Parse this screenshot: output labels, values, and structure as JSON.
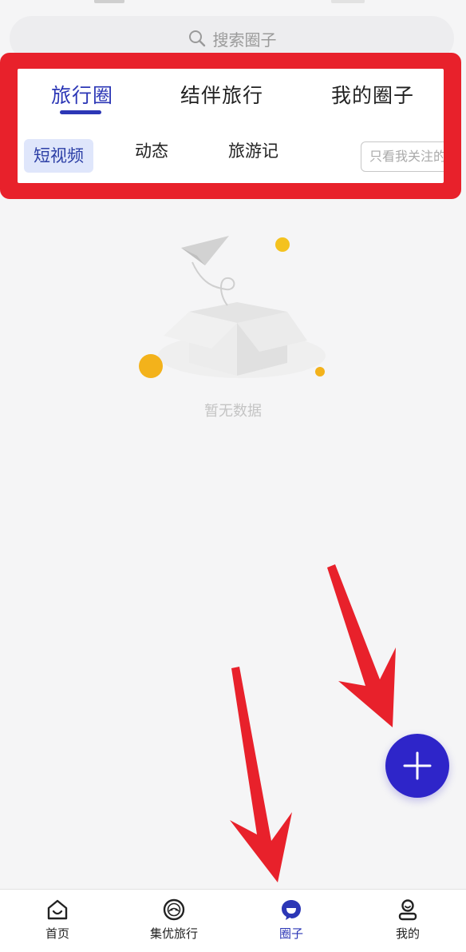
{
  "search": {
    "placeholder": "搜索圈子",
    "icon": "search-icon"
  },
  "main_tabs": [
    {
      "label": "旅行圈",
      "active": true
    },
    {
      "label": "结伴旅行",
      "active": false
    },
    {
      "label": "我的圈子",
      "active": false
    }
  ],
  "sub_tabs": [
    {
      "label": "短视频",
      "active": true
    },
    {
      "label": "动态",
      "active": false
    },
    {
      "label": "旅游记",
      "active": false
    }
  ],
  "follow_filter": {
    "label": "只看我关注的"
  },
  "empty_state": {
    "text": "暂无数据"
  },
  "fab": {
    "icon": "plus-icon"
  },
  "bottom_nav": [
    {
      "label": "首页",
      "icon": "home-icon",
      "active": false
    },
    {
      "label": "集优旅行",
      "icon": "travel-logo-icon",
      "active": false
    },
    {
      "label": "圈子",
      "icon": "circle-chat-icon",
      "active": true
    },
    {
      "label": "我的",
      "icon": "profile-icon",
      "active": false
    }
  ],
  "colors": {
    "accent": "#2c37b6",
    "fab": "#2e25c9",
    "highlight_border": "#e8212b",
    "background": "#f5f5f6"
  }
}
